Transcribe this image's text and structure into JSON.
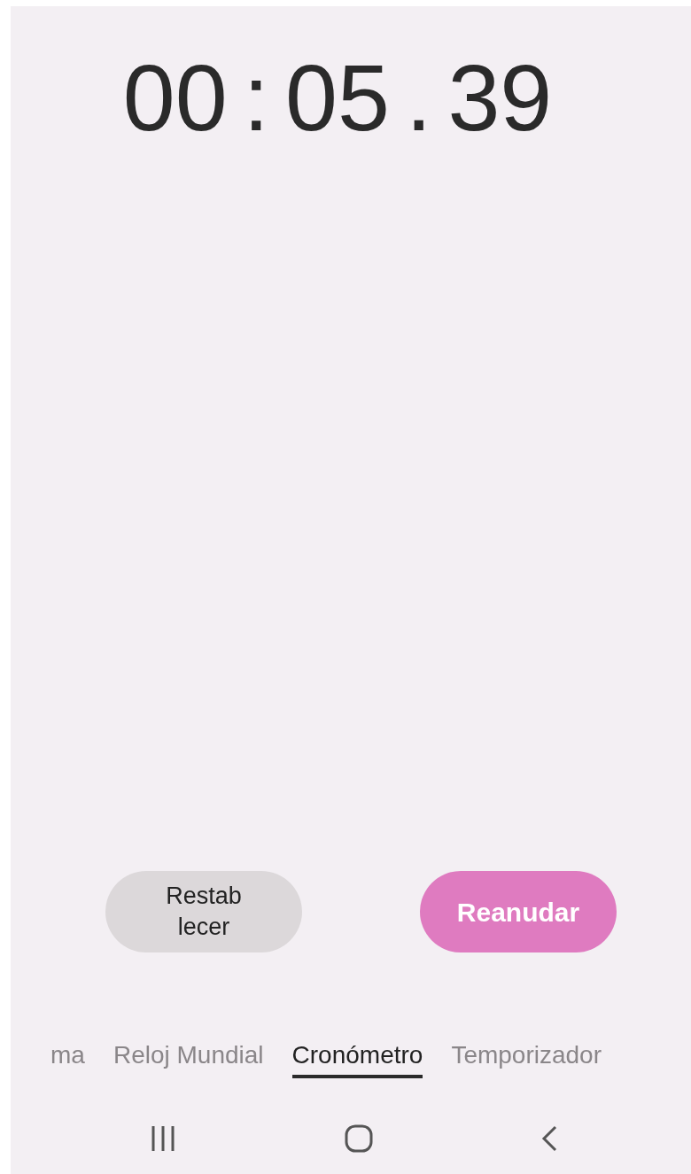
{
  "time": {
    "parts": [
      "00",
      ":",
      "05",
      ".",
      "39"
    ]
  },
  "buttons": [
    {
      "label": "Restab\nlecer",
      "kind": "secondary"
    },
    {
      "label": "Reanudar",
      "kind": "primary"
    }
  ],
  "tabs": [
    {
      "label": "ma",
      "selected": false
    },
    {
      "label": "Reloj Mundial",
      "selected": false
    },
    {
      "label": "Cronómetro",
      "selected": true
    },
    {
      "label": "Temporizador",
      "selected": false
    }
  ]
}
